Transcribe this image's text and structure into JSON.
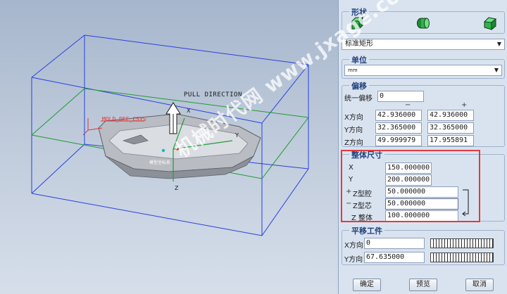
{
  "viewport": {
    "pull_direction_label": "PULL DIRECTION",
    "csys_label": "MOLD_DEF_CSYS",
    "axis_x": "X",
    "axis_y": "Y",
    "axis_z": "Z",
    "part_origin_label": "模型坐标系"
  },
  "panel": {
    "shape": {
      "title": "形状",
      "icons": [
        "green-box-icon",
        "green-cylinder-icon",
        "green-custom-shape-icon"
      ],
      "selected": "标准矩形"
    },
    "unit": {
      "title": "单位",
      "selected": "mm"
    },
    "offset": {
      "title": "偏移",
      "uniform_label": "统一偏移",
      "uniform_value": "0",
      "minus_sign": "−",
      "plus_sign": "+",
      "rows": [
        {
          "label": "X方向",
          "minus": "42.936000",
          "plus": "42.936000"
        },
        {
          "label": "Y方向",
          "minus": "32.365000",
          "plus": "32.365000"
        },
        {
          "label": "Z方向",
          "minus": "49.999979",
          "plus": "17.955891"
        }
      ]
    },
    "overall": {
      "title": "整体尺寸",
      "x_label": "X",
      "x_value": "150.000000",
      "y_label": "Y",
      "y_value": "200.000000",
      "zcav_sign": "+",
      "zcav_label": "Z型腔",
      "zcav_value": "50.000000",
      "zcore_sign": "−",
      "zcore_label": "Z型芯",
      "zcore_value": "50.000000",
      "ztot_label": "Z 整体",
      "ztot_value": "100.000000"
    },
    "translate": {
      "title": "平移工件",
      "x_label": "X方向",
      "x_value": "0",
      "y_label": "Y方向",
      "y_value": "67.635000"
    },
    "buttons": {
      "ok": "确定",
      "preview": "预览",
      "cancel": "取消"
    }
  },
  "watermark": "机械时代网 www.jxage.com",
  "colors": {
    "accent_red": "#e53a3a",
    "title_blue": "#1f3f7a",
    "workpiece_blue": "#2a3fe0",
    "parting_green": "#1f9a2f"
  }
}
